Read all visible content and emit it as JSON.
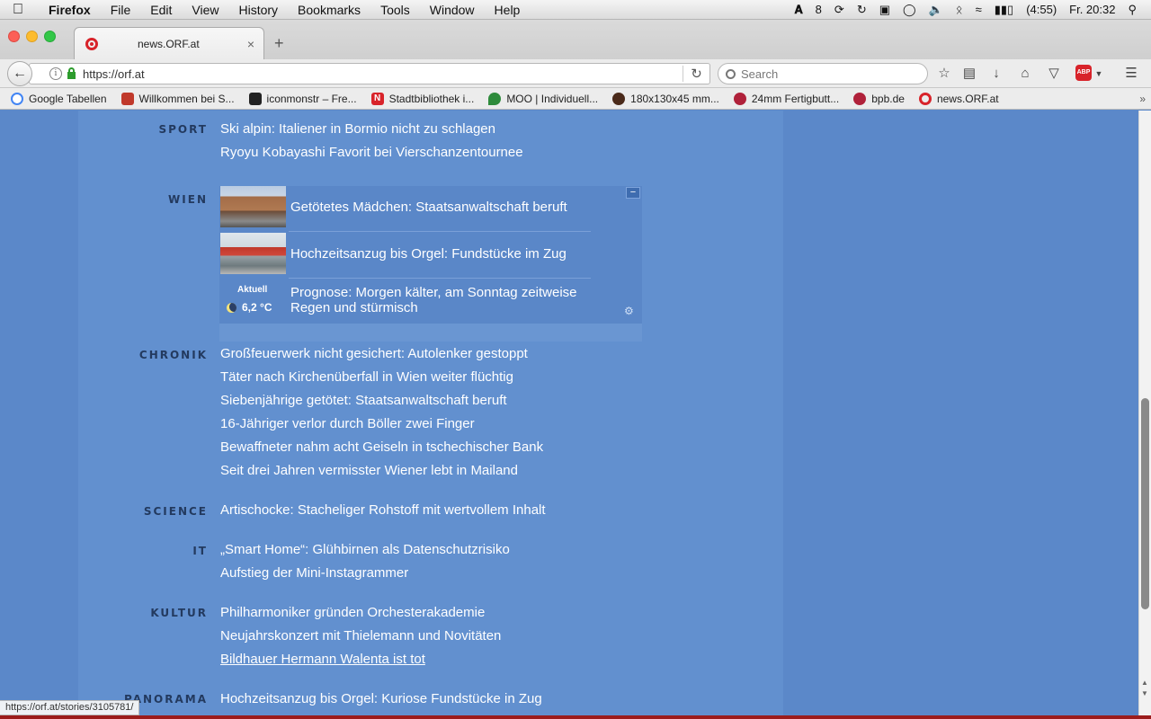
{
  "menubar": {
    "app": "Firefox",
    "items": [
      "File",
      "Edit",
      "View",
      "History",
      "Bookmarks",
      "Tools",
      "Window",
      "Help"
    ],
    "adobe_count": "8",
    "battery": "(4:55)",
    "clock": "Fr. 20:32"
  },
  "tab": {
    "title": "news.ORF.at",
    "close": "×",
    "new": "+"
  },
  "nav": {
    "url": "https://orf.at",
    "search_placeholder": "Search"
  },
  "bookmarks": [
    {
      "label": "Google Tabellen",
      "color": "#34a853"
    },
    {
      "label": "Willkommen bei S...",
      "color": "#c0392b"
    },
    {
      "label": "iconmonstr – Fre...",
      "color": "#222222"
    },
    {
      "label": "Stadtbibliothek i...",
      "color": "#d8232a"
    },
    {
      "label": "MOO | Individuell...",
      "color": "#2e8b3c"
    },
    {
      "label": "180x130x45 mm...",
      "color": "#4a2a1a"
    },
    {
      "label": "24mm Fertigbutt...",
      "color": "#b0213a"
    },
    {
      "label": "bpb.de",
      "color": "#b0213a"
    },
    {
      "label": "news.ORF.at",
      "color": "#d8232a"
    }
  ],
  "sections": {
    "sport": {
      "label": "SPORT",
      "headlines": [
        "Ski alpin: Italiener in Bormio nicht zu schlagen",
        "Ryoyu Kobayashi Favorit bei Vierschanzentournee"
      ]
    },
    "wien": {
      "label": "WIEN",
      "stories": [
        "Getötetes Mädchen: Staatsanwaltschaft beruft",
        "Hochzeitsanzug bis Orgel: Fundstücke im Zug"
      ],
      "weather": {
        "label": "Aktuell",
        "temp": "6,2 °C",
        "forecast_line1": "Prognose: Morgen kälter, am Sonntag zeitweise",
        "forecast_line2": "Regen und stürmisch"
      },
      "collapse": "−"
    },
    "chronik": {
      "label": "CHRONIK",
      "headlines": [
        "Großfeuerwerk nicht gesichert: Autolenker gestoppt",
        "Täter nach Kirchenüberfall in Wien weiter flüchtig",
        "Siebenjährige getötet: Staatsanwaltschaft beruft",
        "16-Jähriger verlor durch Böller zwei Finger",
        "Bewaffneter nahm acht Geiseln in tschechischer Bank",
        "Seit drei Jahren vermisster Wiener lebt in Mailand"
      ]
    },
    "science": {
      "label": "SCIENCE",
      "headlines": [
        "Artischocke: Stacheliger Rohstoff mit wertvollem Inhalt"
      ]
    },
    "it": {
      "label": "IT",
      "headlines": [
        "„Smart Home“: Glühbirnen als Datenschutzrisiko",
        "Aufstieg der Mini-Instagrammer"
      ]
    },
    "kultur": {
      "label": "KULTUR",
      "headlines": [
        "Philharmoniker gründen Orchesterakademie",
        "Neujahrskonzert mit Thielemann und Novitäten",
        "Bildhauer Hermann Walenta ist tot"
      ]
    },
    "panorama": {
      "label": "PANORAMA",
      "headlines": [
        "Hochzeitsanzug bis Orgel: Kuriose Fundstücke in Zug"
      ]
    }
  },
  "status_url": "https://orf.at/stories/3105781/"
}
